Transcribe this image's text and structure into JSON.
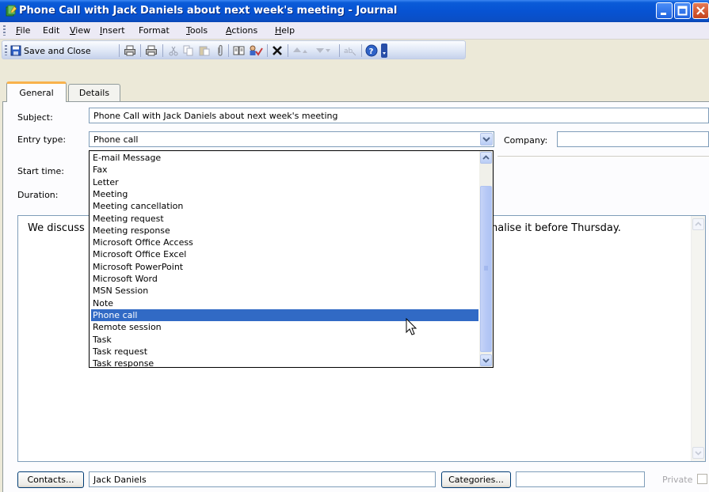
{
  "window": {
    "title": "Phone Call with Jack Daniels about next week's meeting - Journal"
  },
  "menu": {
    "items": [
      {
        "label": "File",
        "ul": "F",
        "rest": "ile"
      },
      {
        "label": "Edit",
        "ul": "",
        "rest": "Edit"
      },
      {
        "label": "View",
        "ul": "V",
        "rest": "iew"
      },
      {
        "label": "Insert",
        "ul": "I",
        "rest": "nsert"
      },
      {
        "label": "Format",
        "ul": "",
        "rest": "Format"
      },
      {
        "label": "Tools",
        "ul": "T",
        "rest": "ools"
      },
      {
        "label": "Actions",
        "ul": "A",
        "rest": "ctions"
      },
      {
        "label": "Help",
        "ul": "H",
        "rest": "elp"
      }
    ]
  },
  "toolbar": {
    "save_close_label": "Save and Close"
  },
  "tabs": {
    "general": "General",
    "details": "Details"
  },
  "form": {
    "subject_label": "Subject:",
    "subject_value": "Phone Call with Jack Daniels about next week's meeting",
    "entry_type_label": "Entry type:",
    "entry_type_value": "Phone call",
    "company_label": "Company:",
    "company_value": "",
    "start_time_label": "Start time:",
    "duration_label": "Duration:"
  },
  "body": {
    "text_left": "We discuss",
    "text_right": "nalise it before Thursday."
  },
  "dropdown": {
    "items": [
      "E-mail Message",
      "Fax",
      "Letter",
      "Meeting",
      "Meeting cancellation",
      "Meeting request",
      "Meeting response",
      "Microsoft Office Access",
      "Microsoft Office Excel",
      "Microsoft PowerPoint",
      "Microsoft Word",
      "MSN Session",
      "Note",
      "Phone call",
      "Remote session",
      "Task",
      "Task request",
      "Task response"
    ],
    "selected": "Phone call"
  },
  "footer": {
    "contacts_button": "Contacts...",
    "contacts_value": "Jack Daniels",
    "categories_button": "Categories...",
    "categories_value": "",
    "private_label": "Private"
  },
  "colors": {
    "titlebar": "#0753d3",
    "selection": "#316ac5",
    "tab_highlight": "#f8b24c"
  }
}
